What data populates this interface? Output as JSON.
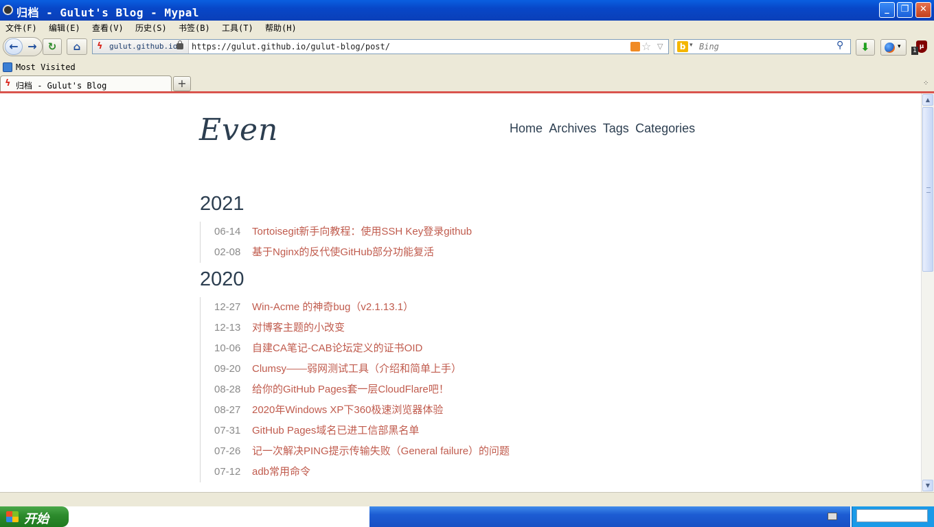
{
  "window": {
    "title": "归档 - Gulut's Blog - Mypal",
    "minimize": "_",
    "maximize": "❐",
    "close": "✕"
  },
  "menubar": {
    "items": [
      "文件(F)",
      "编辑(E)",
      "查看(V)",
      "历史(S)",
      "书签(B)",
      "工具(T)",
      "帮助(H)"
    ]
  },
  "toolbar": {
    "back_icon": "←",
    "forward_icon": "→",
    "reload_icon": "↻",
    "home_icon": "⌂",
    "identity_host": "gulut.github.io",
    "url": "https://gulut.github.io/gulut-blog/post/",
    "search_engine": "b",
    "search_placeholder": "Bing",
    "download_icon": "⬇",
    "ublock_count": "1"
  },
  "bookmarks": {
    "items": [
      {
        "label": "Most Visited",
        "icon": "bookmark-folder-icon"
      }
    ]
  },
  "tabs": {
    "items": [
      {
        "title": "归档 - Gulut's Blog",
        "favicon": "flash-icon"
      }
    ],
    "new_tab": "+"
  },
  "page": {
    "logo": "Even",
    "nav": [
      "Home",
      "Archives",
      "Tags",
      "Categories"
    ],
    "archive": [
      {
        "year": "2021",
        "posts": [
          {
            "date": "06-14",
            "title": "Tortoisegit新手向教程：使用SSH Key登录github"
          },
          {
            "date": "02-08",
            "title": "基于Nginx的反代使GitHub部分功能复活"
          }
        ]
      },
      {
        "year": "2020",
        "posts": [
          {
            "date": "12-27",
            "title": "Win-Acme 的神奇bug（v2.1.13.1）"
          },
          {
            "date": "12-13",
            "title": "对博客主题的小改变"
          },
          {
            "date": "10-06",
            "title": "自建CA笔记-CAB论坛定义的证书OID"
          },
          {
            "date": "09-20",
            "title": "Clumsy——弱网测试工具（介绍和简单上手）"
          },
          {
            "date": "08-28",
            "title": "给你的GitHub Pages套一层CloudFlare吧！"
          },
          {
            "date": "08-27",
            "title": "2020年Windows XP下360极速浏览器体验"
          },
          {
            "date": "07-31",
            "title": "GitHub Pages域名已进工信部黑名单"
          },
          {
            "date": "07-26",
            "title": "记一次解决PING提示传输失败（General failure）的问题"
          },
          {
            "date": "07-12",
            "title": "adb常用命令"
          }
        ]
      }
    ]
  },
  "taskbar": {
    "start_label": "开始"
  },
  "colors": {
    "accent_link": "#c05b4d",
    "heading": "#2c3e50",
    "titlebar": "#0a4fd0"
  }
}
